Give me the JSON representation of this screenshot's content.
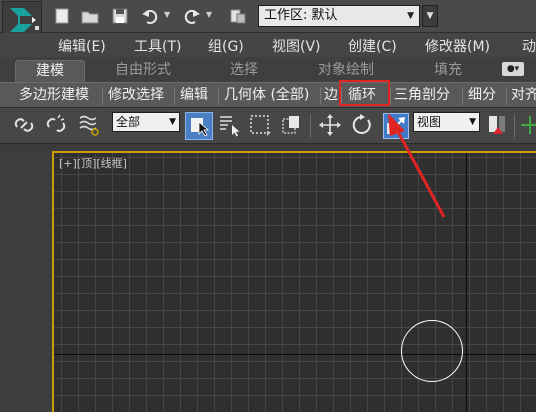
{
  "titlebar": {
    "workspace_label": "工作区: 默认"
  },
  "menu": {
    "items": [
      "编辑(E)",
      "工具(T)",
      "组(G)",
      "视图(V)",
      "创建(C)",
      "修改器(M)",
      "动"
    ]
  },
  "ribbon": {
    "tabs": [
      "建模",
      "自由形式",
      "选择",
      "对象绘制",
      "填充"
    ],
    "active_tab": "建模"
  },
  "subribbon": {
    "items": [
      "多边形建模",
      "修改选择",
      "编辑",
      "几何体 (全部)",
      "边",
      "循环",
      "三角剖分",
      "细分",
      "对齐"
    ],
    "highlighted": "循环"
  },
  "toolbar": {
    "selection_filter": "全部",
    "reference_coord": "视图"
  },
  "viewport": {
    "label": "[+][顶][线框]",
    "active_border_color": "#c9a000"
  },
  "annotation": {
    "color": "#e02424"
  }
}
